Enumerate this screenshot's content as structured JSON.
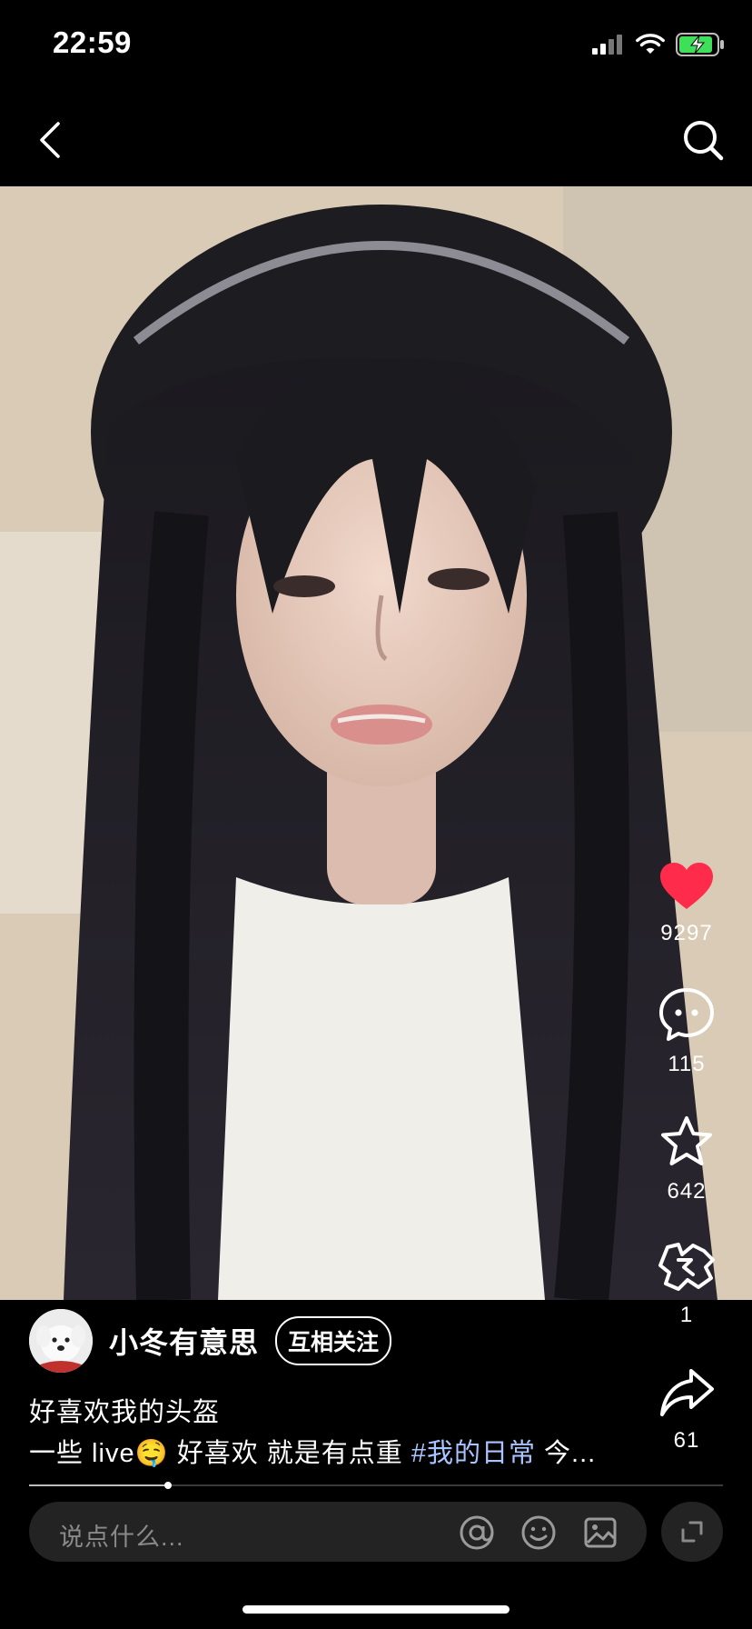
{
  "status_bar": {
    "time": "22:59",
    "battery_charging": true
  },
  "nav": {
    "back_icon": "chevron-left-icon",
    "search_icon": "search-icon"
  },
  "video": {
    "description": ""
  },
  "actions": {
    "like": {
      "icon": "heart-icon",
      "count": "9297",
      "color": "#ff2b4b",
      "liked": true
    },
    "comment": {
      "icon": "comment-bubble-icon",
      "count": "115"
    },
    "favorite": {
      "icon": "star-icon",
      "count": "642"
    },
    "treat": {
      "icon": "treat-icon",
      "count": "1"
    },
    "share": {
      "icon": "share-arrow-icon",
      "count": "61"
    }
  },
  "author": {
    "name": "小冬有意思",
    "relation": "互相关注",
    "avatar_icon": "dog-avatar"
  },
  "caption": {
    "title": "好喜欢我的头盔",
    "line2_text": "一些 live🤤 好喜欢 就是有点重 ",
    "hashtag": "#我的日常",
    "line2_suffix": " 今..."
  },
  "progress": {
    "value": 0.2,
    "accent": "#bdbdbd"
  },
  "comment_input": {
    "placeholder": "说点什么...",
    "icons": [
      "at-icon",
      "emoji-icon",
      "image-icon"
    ],
    "expand_icon": "expand-icon"
  }
}
